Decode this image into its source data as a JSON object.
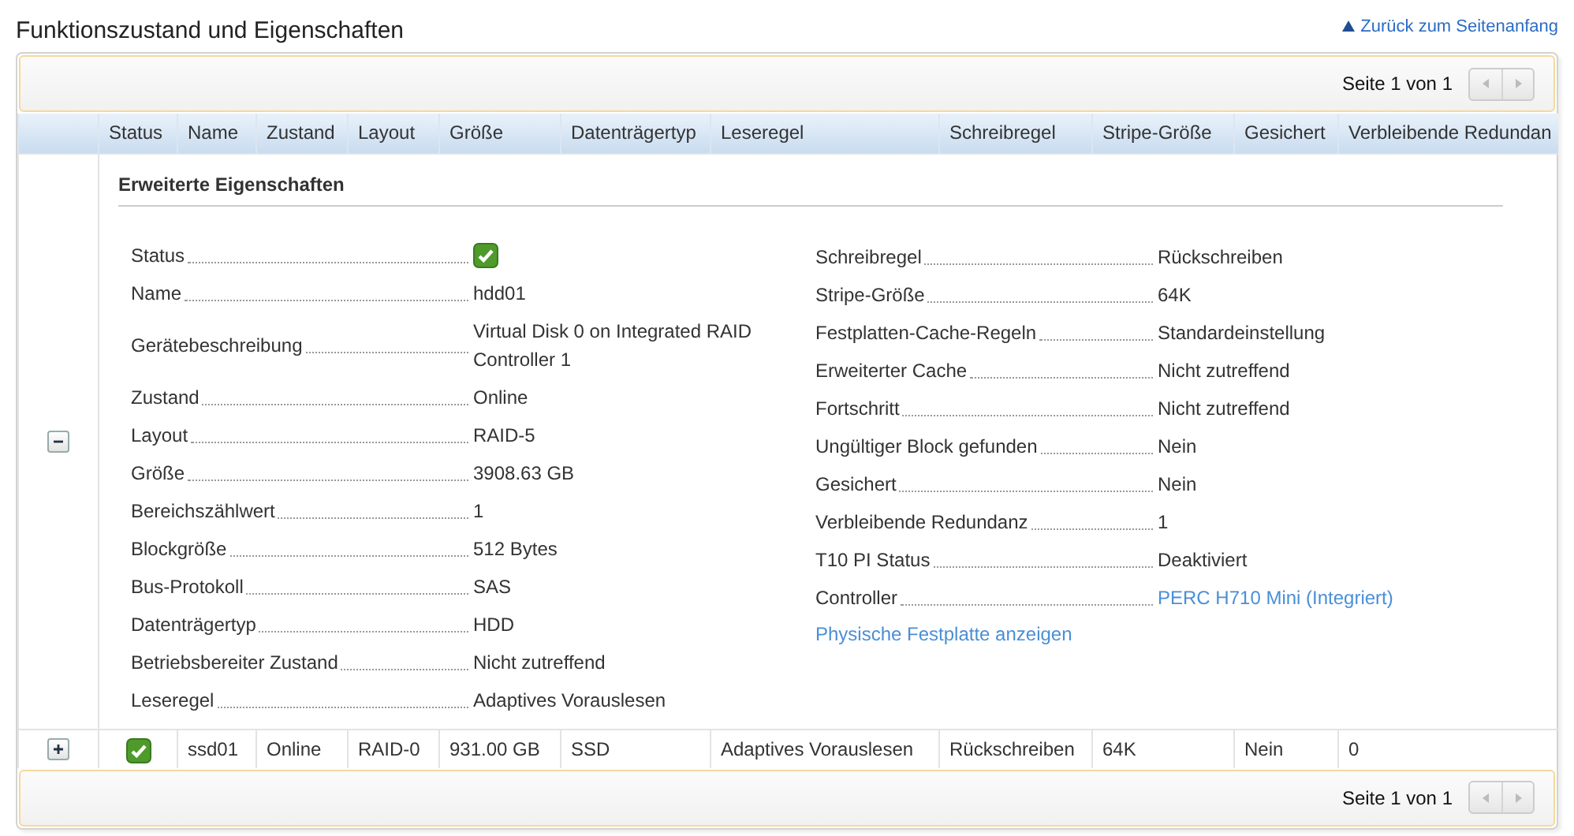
{
  "section_title": "Funktionszustand und Eigenschaften",
  "back_link": "Zurück zum Seitenanfang",
  "top_pager": {
    "text": "Seite 1 von 1",
    "prev_disabled": true,
    "next_disabled": true
  },
  "columns": [
    "Status",
    "Name",
    "Zustand",
    "Layout",
    "Größe",
    "Datenträgertyp",
    "Leseregel",
    "Schreibregel",
    "Stripe-Größe",
    "Gesichert",
    "Verbleibende Redundan"
  ],
  "disks": [
    {
      "expanded": true,
      "details": {
        "heading": "Erweiterte Eigenschaften",
        "left": [
          {
            "kind": "status",
            "label": "Status",
            "healthy": true
          },
          {
            "kind": "text",
            "label": "Name",
            "value": "hdd01"
          },
          {
            "kind": "text",
            "label": "Gerätebeschreibung",
            "value": "Virtual Disk 0 on Integrated RAID Controller 1"
          },
          {
            "kind": "text",
            "label": "Zustand",
            "value": "Online"
          },
          {
            "kind": "text",
            "label": "Layout",
            "value": "RAID-5"
          },
          {
            "kind": "text",
            "label": "Größe",
            "value": "3908.63 GB"
          },
          {
            "kind": "text",
            "label": "Bereichszählwert",
            "value": "1"
          },
          {
            "kind": "text",
            "label": "Blockgröße",
            "value": "512 Bytes"
          },
          {
            "kind": "text",
            "label": "Bus-Protokoll",
            "value": "SAS"
          },
          {
            "kind": "text",
            "label": "Datenträgertyp",
            "value": "HDD"
          },
          {
            "kind": "text",
            "label": "Betriebsbereiter Zustand",
            "value": "Nicht zutreffend"
          },
          {
            "kind": "text",
            "label": "Leseregel",
            "value": "Adaptives Vorauslesen"
          }
        ],
        "right": [
          {
            "kind": "text",
            "label": "Schreibregel",
            "value": "Rückschreiben"
          },
          {
            "kind": "text",
            "label": "Stripe-Größe",
            "value": "64K"
          },
          {
            "kind": "text",
            "label": "Festplatten-Cache-Regeln",
            "value": "Standardeinstellung"
          },
          {
            "kind": "text",
            "label": "Erweiterter Cache",
            "value": "Nicht zutreffend"
          },
          {
            "kind": "text",
            "label": "Fortschritt",
            "value": "Nicht zutreffend"
          },
          {
            "kind": "text",
            "label": "Ungültiger Block gefunden",
            "value": "Nein"
          },
          {
            "kind": "text",
            "label": "Gesichert",
            "value": "Nein"
          },
          {
            "kind": "text",
            "label": "Verbleibende Redundanz",
            "value": "1"
          },
          {
            "kind": "text",
            "label": "T10 PI Status",
            "value": "Deaktiviert"
          },
          {
            "kind": "link",
            "label": "Controller",
            "value": "PERC H710 Mini (Integriert)"
          }
        ],
        "physical_link": "Physische Festplatte anzeigen"
      }
    },
    {
      "expanded": false,
      "healthy": true,
      "cells": [
        "ssd01",
        "Online",
        "RAID-0",
        "931.00 GB",
        "SSD",
        "Adaptives Vorauslesen",
        "Rückschreiben",
        "64K",
        "Nein",
        "0"
      ]
    }
  ],
  "bottom_pager": {
    "text": "Seite 1 von 1",
    "prev_disabled": true,
    "next_disabled": true
  }
}
